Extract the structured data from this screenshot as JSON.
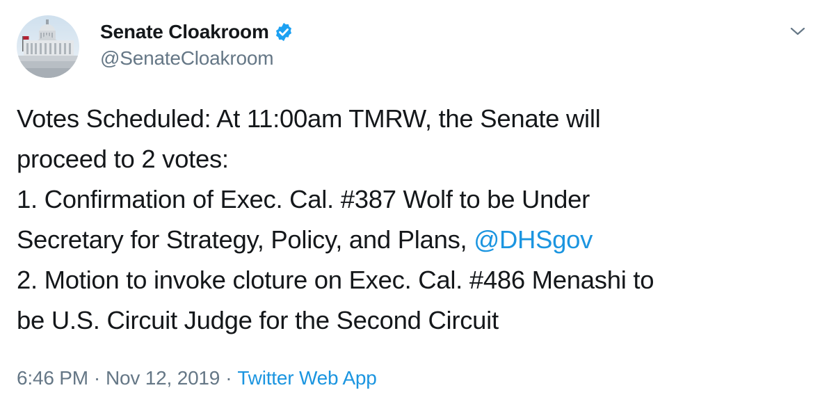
{
  "author": {
    "display_name": "Senate Cloakroom",
    "handle": "@SenateCloakroom",
    "verified": true,
    "avatar_icon": "capitol-building-avatar"
  },
  "menu": {
    "icon": "chevron-down-icon"
  },
  "tweet": {
    "line1": "Votes Scheduled: At 11:00am TMRW, the Senate will",
    "line2": "proceed to 2 votes:",
    "line3": "1. Confirmation of Exec. Cal. #387 Wolf to be Under",
    "line4_text": "Secretary for Strategy, Policy, and Plans, ",
    "line4_mention": "@DHSgov",
    "line5": "2. Motion to invoke cloture on Exec. Cal. #486 Menashi to",
    "line6": "be U.S. Circuit Judge for the Second Circuit"
  },
  "meta": {
    "time": "6:46 PM",
    "separator": "·",
    "date": "Nov 12, 2019",
    "source": "Twitter Web App"
  },
  "colors": {
    "text": "#14171a",
    "secondary": "#657786",
    "link": "#1b95e0",
    "verified_badge": "#1da1f2"
  }
}
